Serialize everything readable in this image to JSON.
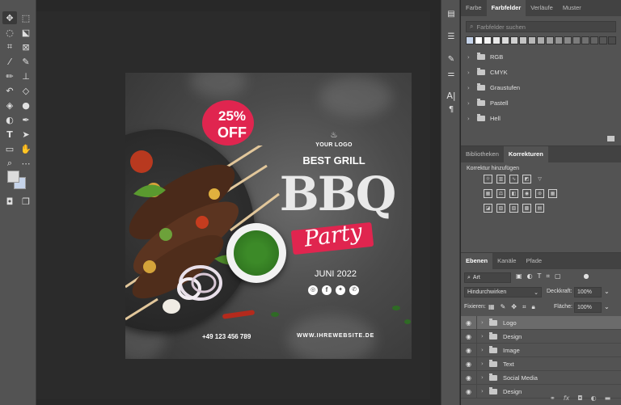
{
  "toolbar": {
    "tools": [
      "move-tool",
      "marquee-tool",
      "lasso-tool",
      "object-select-tool",
      "crop-tool",
      "frame-tool",
      "eyedropper-tool",
      "ruler-tool",
      "brush-tool",
      "stamp-tool",
      "history-brush-tool",
      "eraser-tool",
      "bucket-tool",
      "blur-tool",
      "dodge-tool",
      "pen-tool",
      "type-tool",
      "path-select-tool",
      "rectangle-tool",
      "hand-tool",
      "zoom-tool",
      "more-tools"
    ],
    "foreground_color": "#dcdcdc",
    "background_color": "#c6d4ea"
  },
  "artboard": {
    "discount": "25%",
    "discount_sub": "OFF",
    "logo": "YOUR LOGO",
    "best_grill": "BEST GRILL",
    "headline": "BBQ",
    "subline": "Party",
    "date": "JUNI 2022",
    "phone": "+49 123 456 789",
    "website": "WWW.IHREWEBSITE.DE",
    "accent": "#e0254f"
  },
  "swatches_panel": {
    "tabs": [
      "Farbe",
      "Farbfelder",
      "Verläufe",
      "Muster"
    ],
    "active_tab": "Farbfelder",
    "search_placeholder": "Farbfelder suchen",
    "recent_colors": [
      "#c6d4ea",
      "#ffffff",
      "#f4f4f4",
      "#e8e8e8",
      "#dcdcdc",
      "#d0d0d0",
      "#c4c4c4",
      "#b8b8b8",
      "#acacac",
      "#a0a0a0",
      "#949494",
      "#888888",
      "#7c7c7c",
      "#707070",
      "#646464",
      "#585858",
      "#4c4c4c"
    ],
    "folders": [
      "RGB",
      "CMYK",
      "Graustufen",
      "Pastell",
      "Hell"
    ]
  },
  "adjustments_panel": {
    "tabs": [
      "Bibliotheken",
      "Korrekturen"
    ],
    "active_tab": "Korrekturen",
    "add_label": "Korrektur hinzufügen"
  },
  "layers_panel": {
    "tabs": [
      "Ebenen",
      "Kanäle",
      "Pfade"
    ],
    "active_tab": "Ebenen",
    "filter_value": "Art",
    "blend_mode": "Hindurchwirken",
    "opacity_label": "Deckkraft:",
    "opacity_value": "100%",
    "lock_label": "Fixieren:",
    "fill_label": "Fläche:",
    "fill_value": "100%",
    "layers": [
      "Logo",
      "Design",
      "Image",
      "Text",
      "Social Media",
      "Design"
    ],
    "selected_layer": "Logo",
    "footer_icons": [
      "link-icon",
      "fx-icon",
      "mask-icon",
      "adjustment-icon",
      "group-icon"
    ]
  }
}
